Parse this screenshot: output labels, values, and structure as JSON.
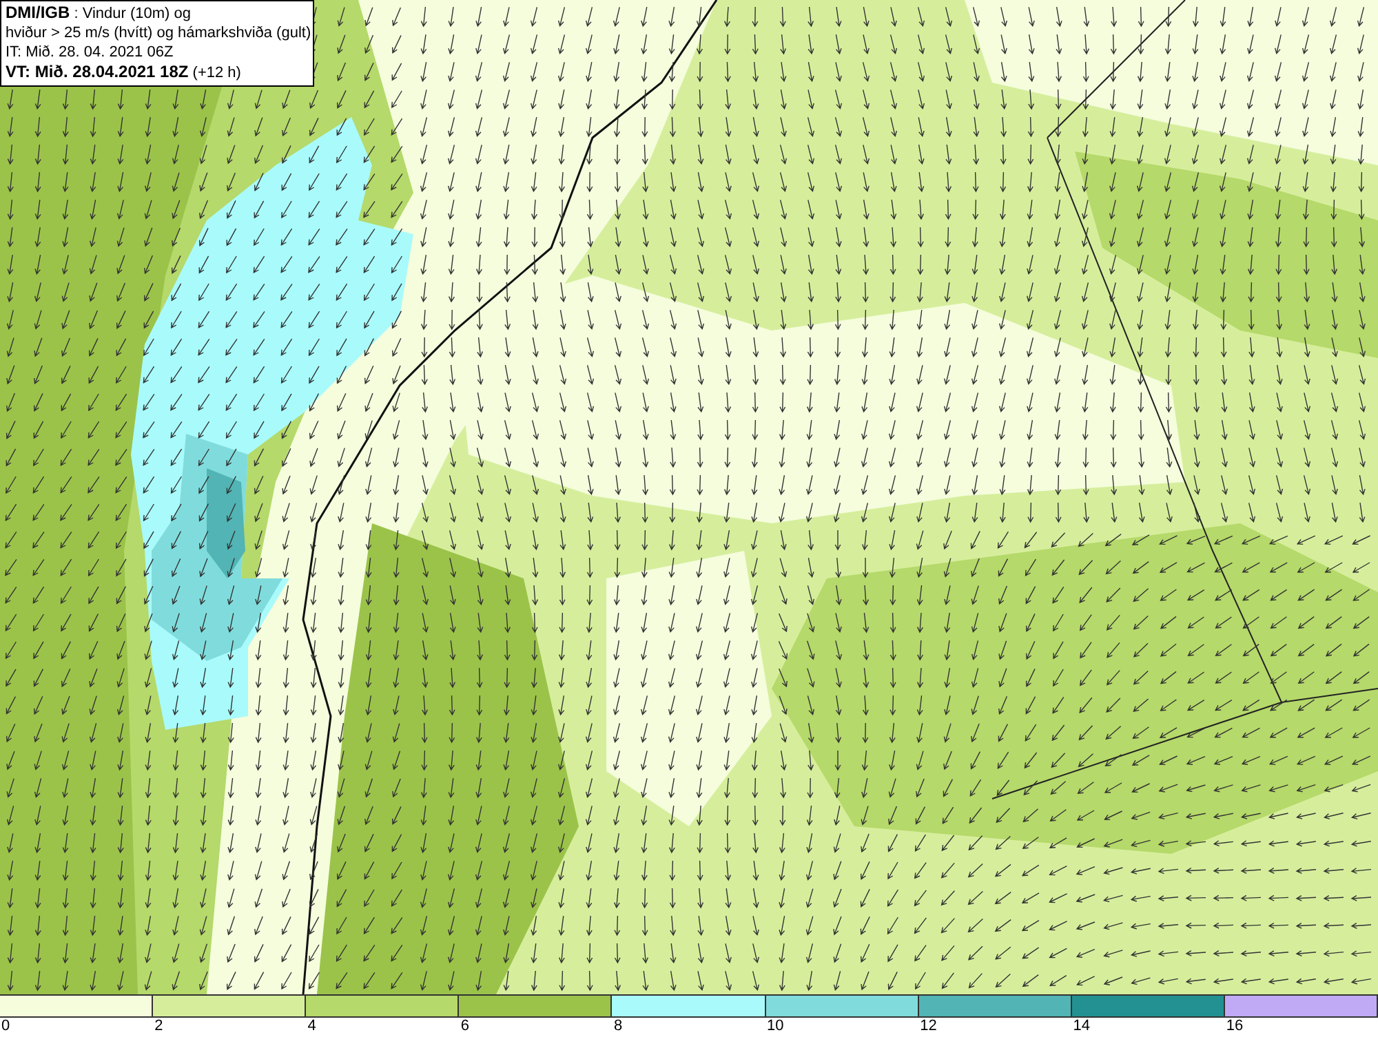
{
  "header": {
    "lines": [
      "**DMI/IGB** : Vindur (10m) og",
      "hviður > 25 m/s (hvítt) og hámarkshviða (gult)",
      "IT: Mið. 28. 04. 2021 06Z",
      "**VT: Mið. 28.04.2021 18Z** (+12 h)"
    ]
  },
  "legend": {
    "bins": [
      {
        "color": "#f5fddd"
      },
      {
        "color": "#d6ee9c"
      },
      {
        "color": "#b5d96a"
      },
      {
        "color": "#9bc34a"
      },
      {
        "color": "#a9fafb"
      },
      {
        "color": "#80dcdc"
      },
      {
        "color": "#52b4b4"
      },
      {
        "color": "#239191"
      },
      {
        "color": "#c0aaf6"
      }
    ],
    "labels": [
      "0",
      "2",
      "4",
      "6",
      "8",
      "10",
      "12",
      "14",
      "16"
    ]
  }
}
